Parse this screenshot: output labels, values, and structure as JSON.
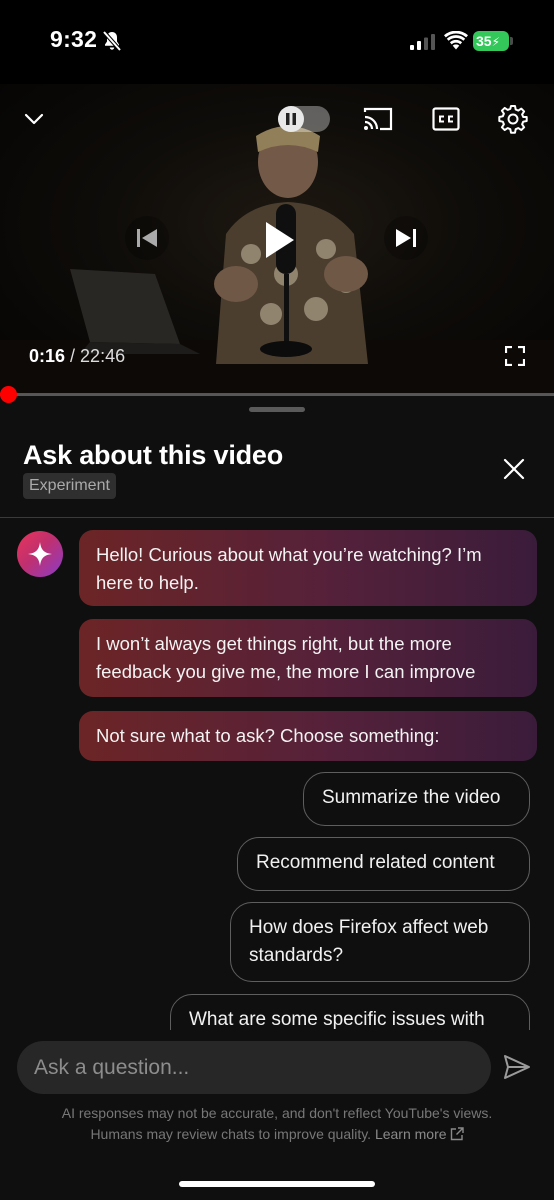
{
  "status_bar": {
    "time": "9:32",
    "battery": "35"
  },
  "player": {
    "current_time": "0:16",
    "separator": " / ",
    "total_time": "22:46",
    "progress_fraction": 0.012,
    "autoplay": "on"
  },
  "panel": {
    "title": "Ask about this video",
    "badge": "Experiment",
    "messages": [
      "Hello! Curious about what you’re watching? I’m here to help.",
      "I won’t always get things right, but the more feedback you give me, the more I can improve",
      "Not sure what to ask? Choose something:"
    ],
    "suggestions": [
      "Summarize the video",
      "Recommend related content",
      "How does Firefox affect web standards?",
      "What are some specific issues with"
    ]
  },
  "composer": {
    "placeholder": "Ask a question...",
    "disclaimer_line1": "AI responses may not be accurate, and don't reflect YouTube's views.",
    "disclaimer_line2": "Humans may review chats to improve quality.",
    "learn_more": "Learn more"
  },
  "colors": {
    "accent": "#ff0000",
    "battery": "#34c759",
    "bubble": "#6c2526"
  },
  "icons": [
    "bell-off-icon",
    "signal-icon",
    "wifi-icon",
    "chevron-down-icon",
    "pause-icon",
    "cast-icon",
    "cc-icon",
    "gear-icon",
    "previous-icon",
    "play-icon",
    "next-icon",
    "fullscreen-icon",
    "close-icon",
    "sparkle-icon",
    "send-icon",
    "external-link-icon"
  ]
}
